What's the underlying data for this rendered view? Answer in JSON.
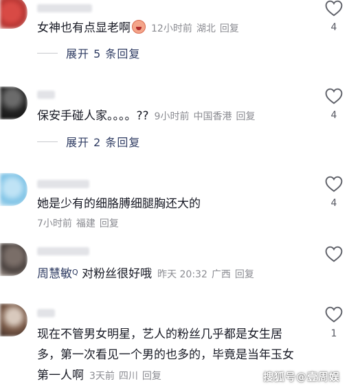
{
  "comments": [
    {
      "text": "女神也有点显老啊",
      "emoji": "crying-face-emoji",
      "time": "12小时前",
      "location": "湖北",
      "reply": "回复",
      "likes": "4",
      "expand": "展开 5 条回复"
    },
    {
      "text": "保安手碰人家。。。。??",
      "time": "9小时前",
      "location": "中国香港",
      "reply": "回复",
      "likes": "4",
      "expand": "展开 2 条回复"
    },
    {
      "text": "她是少有的细胳膊细腿胸还大的",
      "time": "7小时前",
      "location": "福建",
      "reply": "回复",
      "likes": "4"
    },
    {
      "mention": "周慧敏",
      "mention_badge": "Q",
      "text": "对粉丝很好哦",
      "time": "昨天 20:32",
      "location": "广西",
      "reply": "回复",
      "likes": ""
    },
    {
      "text": "现在不管男女明星，艺人的粉丝几乎都是女生居多，第一次看见一个男的也多的，毕竟是当年玉女第一人啊",
      "time": "3天前",
      "location": "四川",
      "reply": "回复",
      "likes": "1"
    }
  ],
  "watermark": "搜狐号@壹周娱",
  "colors": {
    "link": "#2e3b62",
    "meta": "#8a8b91",
    "text": "#161823"
  }
}
